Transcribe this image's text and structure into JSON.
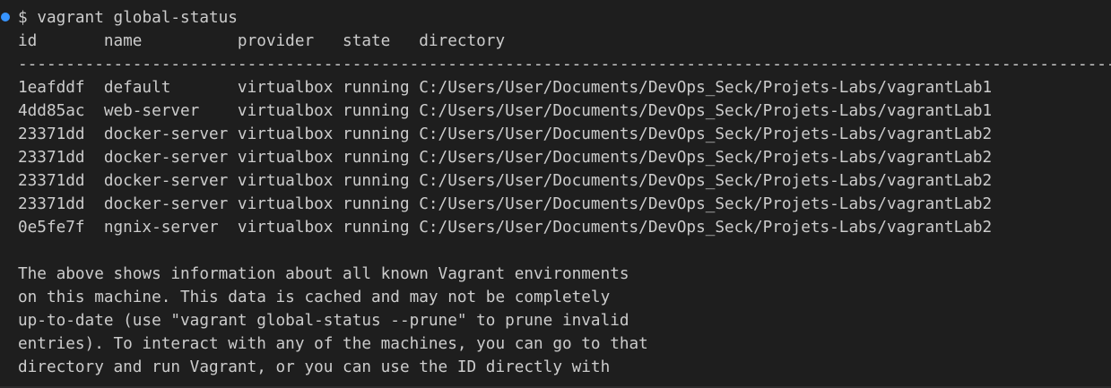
{
  "prompt": {
    "symbol": "$",
    "command": "vagrant global-status"
  },
  "table": {
    "header": "id       name          provider   state   directory",
    "separator": "-----------------------------------------------------------------------------------------------------------------------------",
    "rows": [
      "1eafddf  default       virtualbox running C:/Users/User/Documents/DevOps_Seck/Projets-Labs/vagrantLab1",
      "4dd85ac  web-server    virtualbox running C:/Users/User/Documents/DevOps_Seck/Projets-Labs/vagrantLab1",
      "23371dd  docker-server virtualbox running C:/Users/User/Documents/DevOps_Seck/Projets-Labs/vagrantLab2",
      "23371dd  docker-server virtualbox running C:/Users/User/Documents/DevOps_Seck/Projets-Labs/vagrantLab2",
      "23371dd  docker-server virtualbox running C:/Users/User/Documents/DevOps_Seck/Projets-Labs/vagrantLab2",
      "23371dd  docker-server virtualbox running C:/Users/User/Documents/DevOps_Seck/Projets-Labs/vagrantLab2",
      "0e5fe7f  ngnix-server  virtualbox running C:/Users/User/Documents/DevOps_Seck/Projets-Labs/vagrantLab2"
    ]
  },
  "info": {
    "lines": [
      "The above shows information about all known Vagrant environments",
      "on this machine. This data is cached and may not be completely",
      "up-to-date (use \"vagrant global-status --prune\" to prune invalid",
      "entries). To interact with any of the machines, you can go to that",
      "directory and run Vagrant, or you can use the ID directly with"
    ]
  },
  "colors": {
    "background": "#1e1e1e",
    "text": "#cccccc",
    "prompt_dot": "#3794ff"
  }
}
